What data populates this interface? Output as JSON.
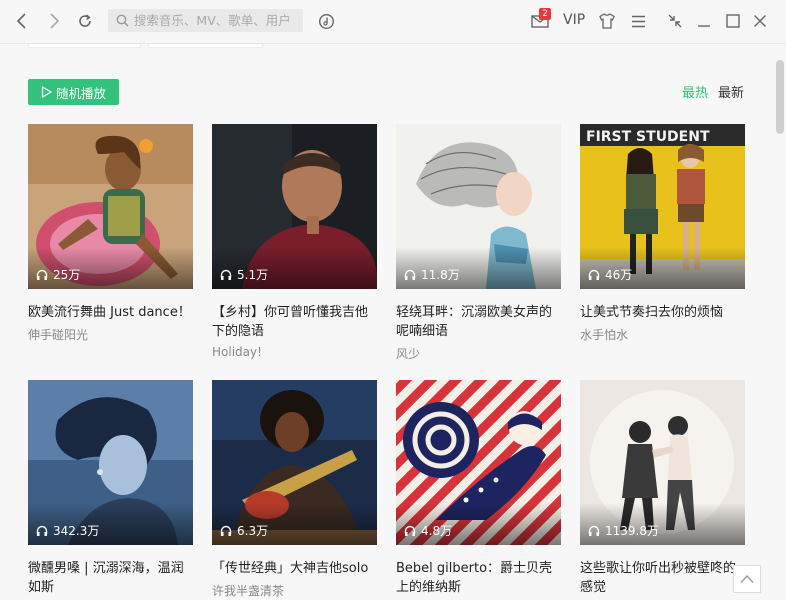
{
  "search": {
    "placeholder": "搜索音乐、MV、歌单、用户"
  },
  "header": {
    "mail_badge": "2",
    "vip_label": "VIP"
  },
  "toolbar": {
    "shuffle_label": "随机播放",
    "sort_hot": "最热",
    "sort_new": "最新"
  },
  "playlists": [
    {
      "count": "25万",
      "title": "欧美流行舞曲 Just dance！",
      "author": "伸手碰阳光",
      "icon": "headphones-icon"
    },
    {
      "count": "5.1万",
      "title": "【乡村】你可曾听懂我吉他下的隐语",
      "author": "Holiday!",
      "icon": "headphones-icon"
    },
    {
      "count": "11.8万",
      "title": "轻绕耳畔：沉溺欧美女声的呢喃细语",
      "author": "风少",
      "icon": "headphones-icon"
    },
    {
      "count": "46万",
      "title": "让美式节奏扫去你的烦恼",
      "author": "水手怕水",
      "icon": "headphones-icon"
    },
    {
      "count": "342.3万",
      "title": "微醺男嗓 | 沉溺深海，温润如斯",
      "author": "",
      "icon": "headphones-icon"
    },
    {
      "count": "6.3万",
      "title": "「传世经典」大神吉他solo",
      "author": "许我半盏清茶",
      "icon": "headphones-icon"
    },
    {
      "count": "4.8万",
      "title": "Bebel gilberto：爵士贝壳上的维纳斯",
      "author": "",
      "icon": "headphones-icon"
    },
    {
      "count": "1139.8万",
      "title": "这些歌让你听出秒被壁咚的感觉",
      "author": "",
      "icon": "headphones-icon"
    }
  ],
  "colors": {
    "accent": "#31c27c",
    "badge": "#e4393c"
  }
}
